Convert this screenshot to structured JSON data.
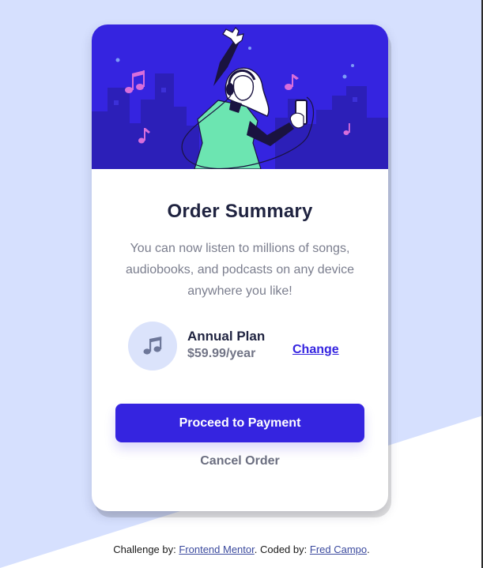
{
  "card": {
    "title": "Order Summary",
    "description": "You can now listen to millions of songs, audiobooks, and podcasts on any device anywhere you like!",
    "plan": {
      "icon": "music-note-icon",
      "name": "Annual Plan",
      "price": "$59.99/year",
      "change_label": "Change"
    },
    "primary_button": "Proceed to Payment",
    "secondary_button": "Cancel Order"
  },
  "footer": {
    "challenge_prefix": "Challenge by:",
    "challenge_link": "Frontend Mentor",
    "coded_prefix": ". Coded by:",
    "coded_link": "Fred Campo",
    "suffix": "."
  },
  "colors": {
    "background": "#d6e0fe",
    "primary": "#3524e0",
    "heading": "#1f2340",
    "muted": "#7b7e8e",
    "icon_bg": "#dbe3fb",
    "illustration_green": "#6ce5b1"
  }
}
